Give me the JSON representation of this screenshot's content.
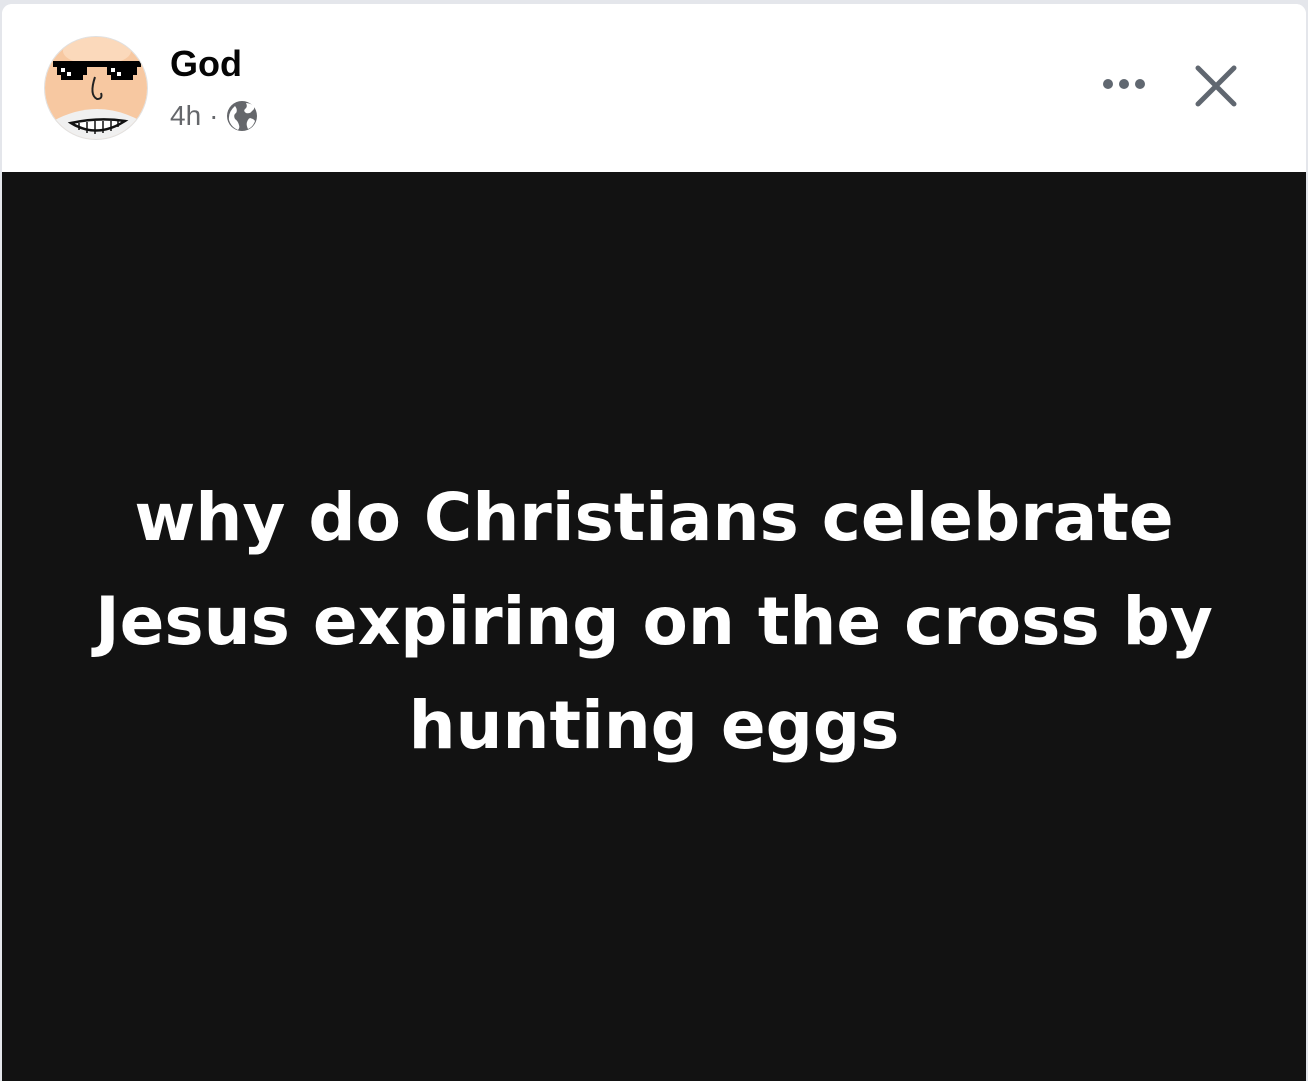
{
  "post": {
    "author": "God",
    "time": "4h",
    "separator": "·",
    "audience_icon": "globe-icon",
    "text": "why do Christians celebrate Jesus expiring on the cross by hunting eggs",
    "background_color": "#121212",
    "text_color": "#ffffff"
  },
  "actions": {
    "more_icon": "more-horizontal-icon",
    "close_icon": "close-icon"
  },
  "colors": {
    "meta_text": "#65676b",
    "author_text": "#050505",
    "icon": "#606770"
  }
}
